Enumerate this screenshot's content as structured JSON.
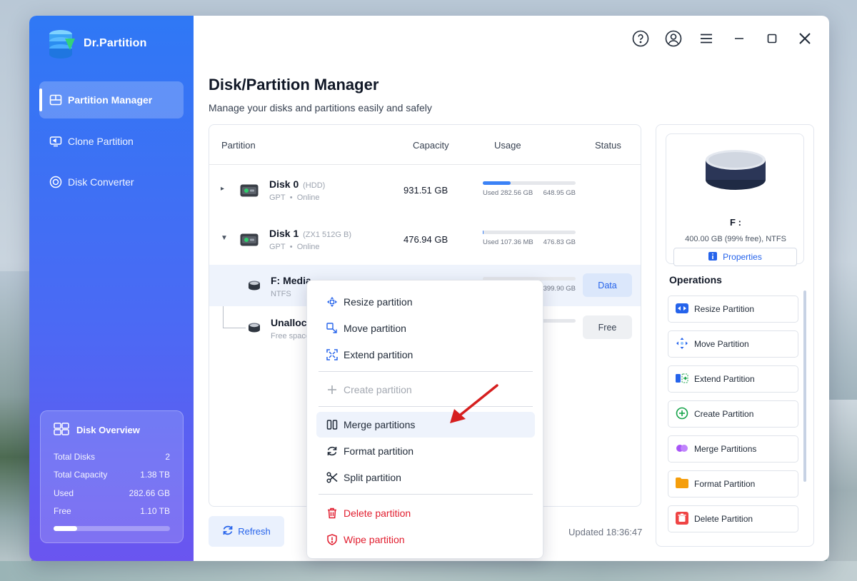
{
  "app": {
    "name": "Dr.Partition"
  },
  "sidebar": {
    "items": [
      {
        "label": "Partition Manager",
        "icon": "partition-manager-icon",
        "active": true
      },
      {
        "label": "Clone Partition",
        "icon": "clone-icon",
        "active": false
      },
      {
        "label": "Disk Converter",
        "icon": "converter-icon",
        "active": false
      }
    ],
    "overview": {
      "title": "Disk Overview",
      "rows": [
        {
          "label": "Total Disks",
          "value": "2"
        },
        {
          "label": "Total Capacity",
          "value": "1.38 TB"
        },
        {
          "label": "Used",
          "value": "282.66 GB"
        },
        {
          "label": "Free",
          "value": "1.10 TB"
        }
      ],
      "used_fraction": 0.2
    }
  },
  "header": {
    "title": "Disk/Partition Manager",
    "subtitle": "Manage your disks and partitions easily and safely"
  },
  "table": {
    "columns": {
      "partition": "Partition",
      "capacity": "Capacity",
      "usage": "Usage",
      "status": "Status"
    },
    "disks": [
      {
        "name": "Disk 0",
        "type": "(HDD)",
        "meta1": "GPT",
        "meta2": "Online",
        "capacity": "931.51 GB",
        "used": "Used 282.56 GB",
        "total": "648.95 GB",
        "usage_fraction": 0.3
      },
      {
        "name": "Disk 1",
        "type": "(ZX1 512G B)",
        "meta1": "GPT",
        "meta2": "Online",
        "capacity": "476.94 GB",
        "used": "Used 107.36 MB",
        "total": "476.83 GB",
        "usage_fraction": 0.0
      }
    ],
    "partitions": [
      {
        "name": "F: Media",
        "meta": "NTFS",
        "total": "399.90 GB",
        "status": "Data"
      },
      {
        "name": "Unalloca",
        "meta": "Free space",
        "status": "Free"
      }
    ]
  },
  "footer": {
    "refresh": "Refresh",
    "updated": "Updated 18:36:47"
  },
  "properties": {
    "volume": "F :",
    "info": "400.00 GB (99% free), NTFS",
    "button": "Properties"
  },
  "operations": {
    "title": "Operations",
    "items": [
      {
        "label": "Resize Partition",
        "icon": "resize-icon",
        "color": "#2563eb"
      },
      {
        "label": "Move Partition",
        "icon": "move-icon",
        "color": "#2563eb"
      },
      {
        "label": "Extend Partition",
        "icon": "extend-icon",
        "color": "#2563eb"
      },
      {
        "label": "Create Partition",
        "icon": "plus-circle-icon",
        "color": "#16a34a"
      },
      {
        "label": "Merge Partitions",
        "icon": "merge-icon",
        "color": "#a855f7"
      },
      {
        "label": "Format Partition",
        "icon": "folder-icon",
        "color": "#f59e0b"
      },
      {
        "label": "Delete Partition",
        "icon": "trash-icon",
        "color": "#ef4444"
      }
    ]
  },
  "context_menu": {
    "items": [
      {
        "label": "Resize partition",
        "icon": "resize-icon"
      },
      {
        "label": "Move partition",
        "icon": "move-icon"
      },
      {
        "label": "Extend partition",
        "icon": "extend-icon"
      },
      {
        "label": "Create partition",
        "icon": "plus-icon",
        "disabled": true
      },
      {
        "label": "Merge partitions",
        "icon": "merge-icon",
        "highlighted": true
      },
      {
        "label": "Format partition",
        "icon": "refresh-icon"
      },
      {
        "label": "Split partition",
        "icon": "scissors-icon"
      },
      {
        "label": "Delete partition",
        "icon": "trash-icon",
        "danger": true
      },
      {
        "label": "Wipe partition",
        "icon": "shield-icon",
        "danger": true
      }
    ]
  },
  "colors": {
    "accent": "#2563eb",
    "sidebar_top": "#2f78f5",
    "sidebar_bottom": "#6a55f0",
    "danger": "#e11d2e"
  }
}
